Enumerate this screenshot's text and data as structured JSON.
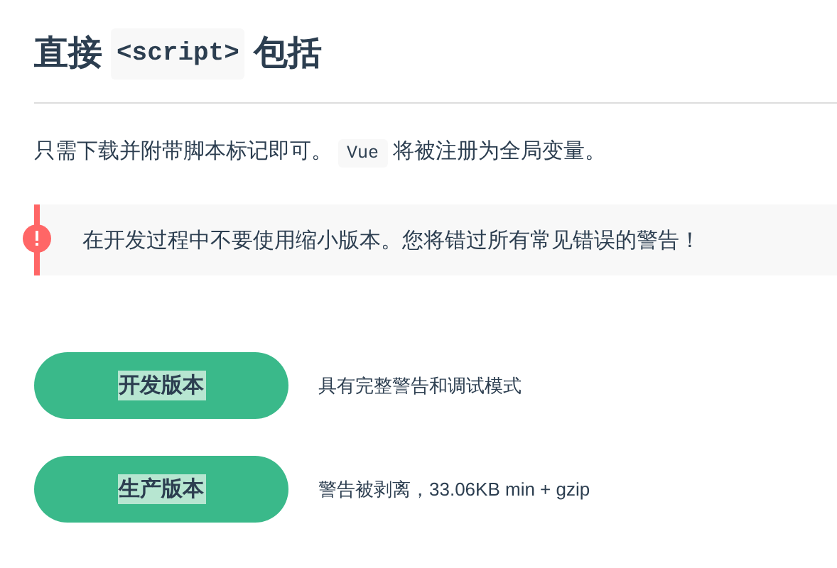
{
  "heading": {
    "before": "直接",
    "code": "<script>",
    "after": "包括"
  },
  "intro": {
    "before": "只需下载并附带脚本标记即可。",
    "code": "Vue",
    "after": "将被注册为全局变量。"
  },
  "warning": {
    "text": "在开发过程中不要使用缩小版本。您将错过所有常见错误的警告！"
  },
  "downloads": [
    {
      "button": "开发版本",
      "description": "具有完整警告和调试模式"
    },
    {
      "button": "生产版本",
      "description": "警告被剥离，33.06KB min + gzip"
    }
  ]
}
